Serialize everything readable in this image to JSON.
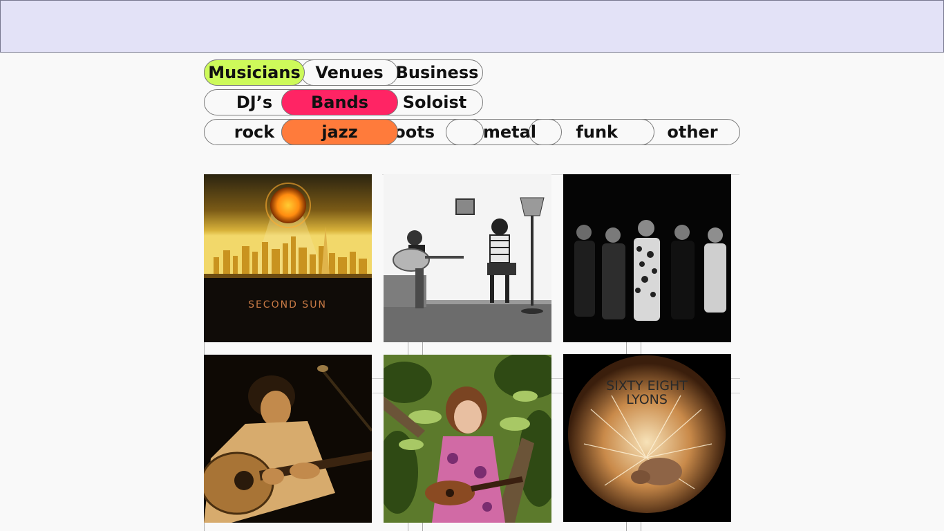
{
  "nav": {
    "category_tabs": [
      {
        "label": "Musicians",
        "active": true
      },
      {
        "label": "Venues",
        "active": false
      },
      {
        "label": "Business",
        "active": false
      }
    ],
    "type_tabs": [
      {
        "label": "DJ’s",
        "active": false
      },
      {
        "label": "Bands",
        "active": true
      },
      {
        "label": "Soloist",
        "active": false
      }
    ],
    "genre_tabs": [
      {
        "label": "rock",
        "active": false
      },
      {
        "label": "jazz",
        "active": true
      },
      {
        "label": "roots",
        "active": false
      },
      {
        "label": "metal",
        "active": false
      },
      {
        "label": "funk",
        "active": false
      },
      {
        "label": "other",
        "active": false
      }
    ]
  },
  "colors": {
    "header_bg": "#e3e2f7",
    "musicians_active": "#cdfa5a",
    "bands_active": "#ff2464",
    "jazz_active": "#ff7b3b"
  },
  "tiles": [
    {
      "caption": "SECOND SUN",
      "image": "city-skyline-sun-album-art"
    },
    {
      "caption": "",
      "image": "duo-guitar-lamp-photo"
    },
    {
      "caption": "",
      "image": "five-member-band-photo"
    },
    {
      "caption": "",
      "image": "guitarist-microphone-photo"
    },
    {
      "caption": "",
      "image": "woman-ukulele-tree-photo"
    },
    {
      "caption": "SIXTY EIGHT LYONS",
      "caption_lines": [
        "SIXTY EIGHT",
        "LYONS"
      ],
      "image": "armadillo-sparks-album-art"
    }
  ]
}
